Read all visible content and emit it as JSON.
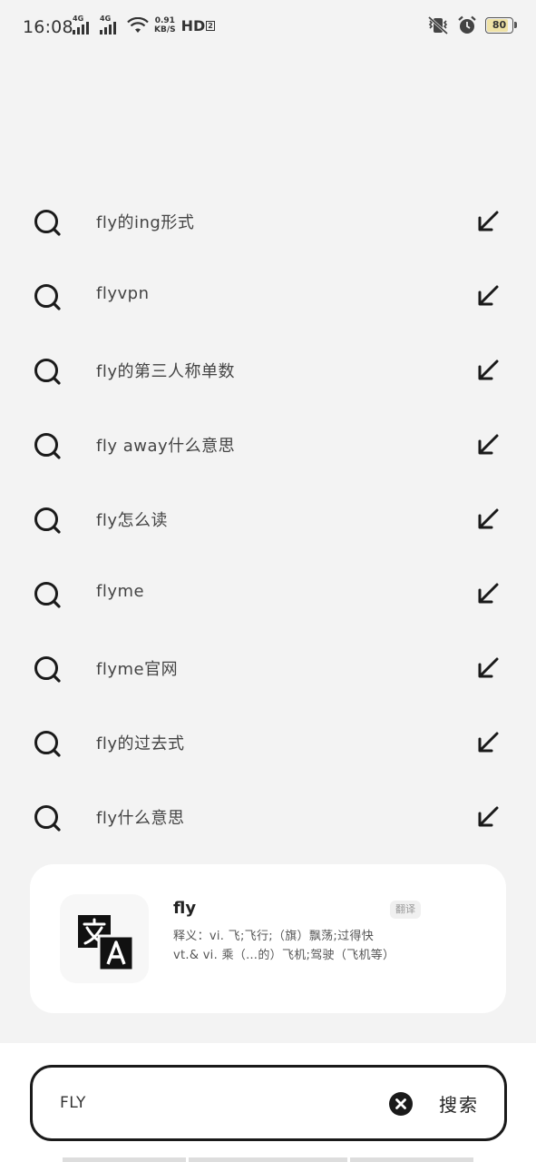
{
  "status_bar": {
    "time": "16:08",
    "signal1_label": "4G",
    "signal2_label": "4G",
    "net_speed_value": "0.91",
    "net_speed_unit": "KB/S",
    "hd_label": "HD",
    "hd_sub": "2",
    "battery": "80"
  },
  "suggestions": [
    {
      "text": "fly的ing形式"
    },
    {
      "text": "flyvpn"
    },
    {
      "text": "fly的第三人称单数"
    },
    {
      "text": "fly away什么意思"
    },
    {
      "text": "fly怎么读"
    },
    {
      "text": "flyme"
    },
    {
      "text": "flyme官网"
    },
    {
      "text": "fly的过去式"
    },
    {
      "text": "fly什么意思"
    }
  ],
  "translate_card": {
    "word": "fly",
    "badge": "翻译",
    "definition_line1": "释义：vi. 飞;飞行;（旗）飘荡;过得快",
    "definition_line2": "vt.& vi. 乘（…的）飞机;驾驶（飞机等）"
  },
  "search_bar": {
    "query": "FLY",
    "search_label": "搜索"
  },
  "colors": {
    "background": "#f3f3f3",
    "card": "#ffffff",
    "icon": "#1a1a1a",
    "battery_fill": "#efe2a6"
  }
}
